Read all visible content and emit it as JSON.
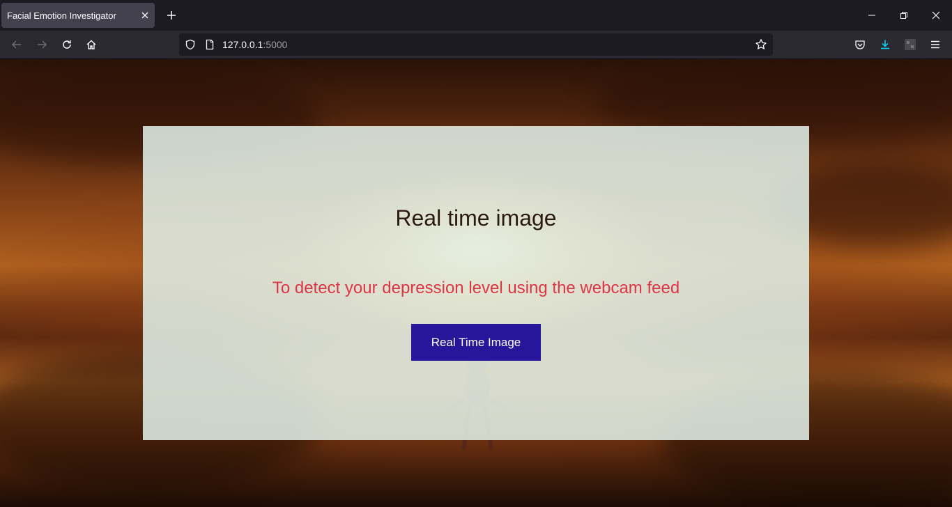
{
  "browser": {
    "tab_title": "Facial Emotion Investigator",
    "url_host": "127.0.0.1",
    "url_port": ":5000"
  },
  "icons": {
    "tab_close": "close-icon",
    "new_tab": "plus-icon",
    "minimize": "minimize-icon",
    "restore": "restore-icon",
    "close": "close-icon",
    "back": "arrow-left-icon",
    "forward": "arrow-right-icon",
    "reload": "reload-icon",
    "home": "home-icon",
    "shield": "shield-icon",
    "page": "page-icon",
    "bookmark": "star-icon",
    "pocket": "pocket-icon",
    "downloads": "download-icon",
    "extension": "extension-icon",
    "menu": "hamburger-menu-icon"
  },
  "colors": {
    "title": "#2a1a10",
    "subtitle": "#dc3545",
    "button": "#1400a0",
    "download_accent": "#00ddff"
  },
  "main": {
    "title": "Real time image",
    "subtitle": "To detect your depression level using the webcam feed",
    "button_label": "Real Time Image"
  }
}
